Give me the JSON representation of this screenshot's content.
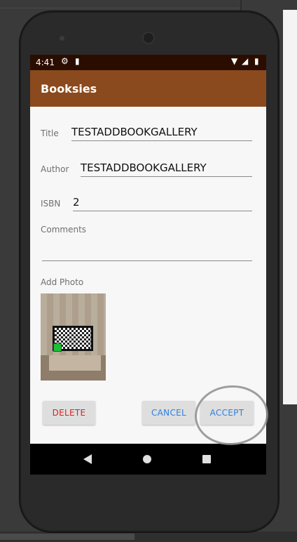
{
  "status_bar": {
    "time": "4:41",
    "icons": [
      "settings-icon",
      "sd-card-icon",
      "wifi-icon",
      "signal-icon",
      "battery-icon"
    ]
  },
  "app_bar": {
    "title": "Booksies",
    "color": "#8a4a1e"
  },
  "form": {
    "title": {
      "label": "Title",
      "value": "TESTADDBOOKGALLERY"
    },
    "author": {
      "label": "Author",
      "value": "TESTADDBOOKGALLERY"
    },
    "isbn": {
      "label": "ISBN",
      "value": "2"
    },
    "comments": {
      "label": "Comments",
      "value": ""
    },
    "photo": {
      "label": "Add Photo"
    }
  },
  "actions": {
    "delete": "DELETE",
    "cancel": "CANCEL",
    "accept": "ACCEPT"
  },
  "colors": {
    "status_bar": "#2b0d00",
    "delete_text": "#e02020",
    "action_text": "#2f80e0"
  }
}
